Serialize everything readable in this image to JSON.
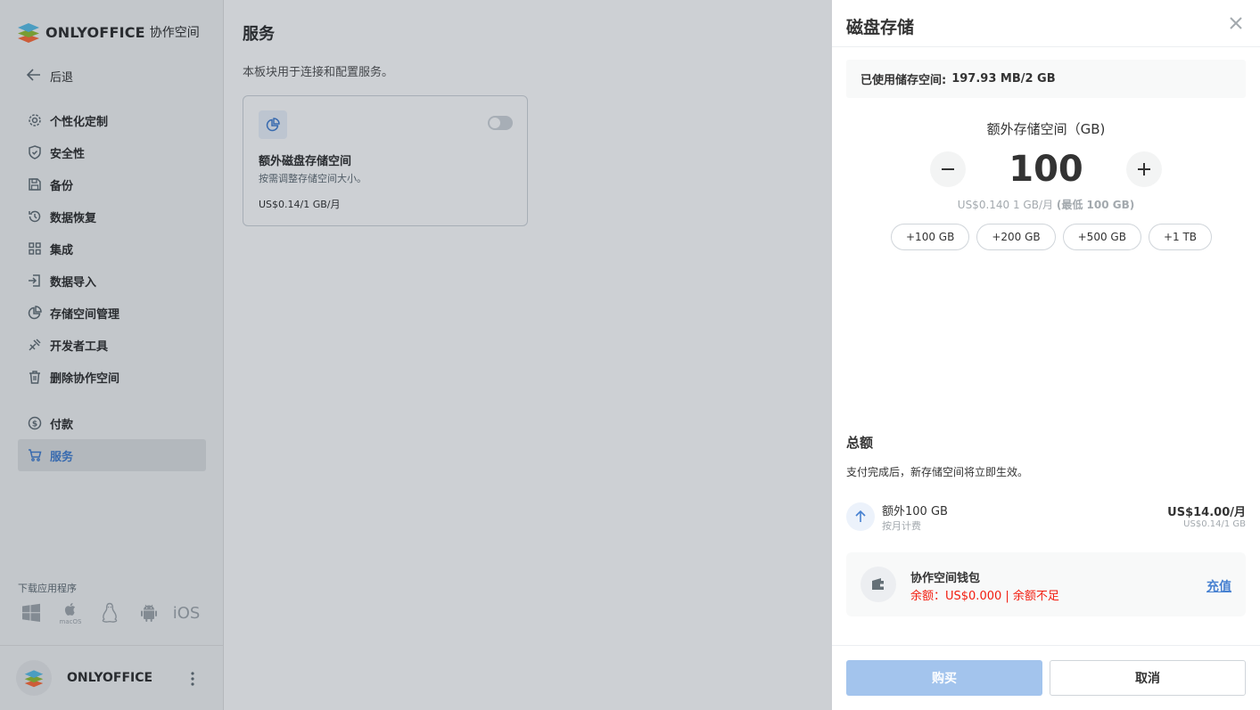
{
  "brand": {
    "name": "ONLYOFFICE",
    "subtitle": "协作空间"
  },
  "sidebar": {
    "back_label": "后退",
    "items": [
      {
        "label": "个性化定制",
        "icon": "gear-icon"
      },
      {
        "label": "安全性",
        "icon": "shield-icon"
      },
      {
        "label": "备份",
        "icon": "save-icon"
      },
      {
        "label": "数据恢复",
        "icon": "restore-icon"
      },
      {
        "label": "集成",
        "icon": "grid-icon"
      },
      {
        "label": "数据导入",
        "icon": "import-icon"
      },
      {
        "label": "存储空间管理",
        "icon": "pie-chart-icon"
      },
      {
        "label": "开发者工具",
        "icon": "tools-icon"
      },
      {
        "label": "删除协作空间",
        "icon": "trash-icon"
      }
    ],
    "items2": [
      {
        "label": "付款",
        "icon": "dollar-icon"
      },
      {
        "label": "服务",
        "icon": "cart-icon",
        "active": true
      }
    ],
    "download_label": "下载应用程序",
    "apps": [
      "windows-icon",
      "macos-icon",
      "linux-icon",
      "android-icon",
      "ios-icon"
    ],
    "macos_label": "macOS",
    "ios_label": "iOS",
    "profile_name": "ONLYOFFICE"
  },
  "main": {
    "title": "服务",
    "description": "本板块用于连接和配置服务。",
    "card": {
      "title": "额外磁盘存储空间",
      "description": "按需调整存储空间大小。",
      "price": "US$0.14/1 GB/月",
      "enabled": false
    }
  },
  "panel": {
    "title": "磁盘存储",
    "used_label": "已使用储存空间:",
    "used_value": "197.93 MB/2 GB",
    "extra_label": "额外存储空间（GB)",
    "quantity": "100",
    "unit_price": "US$0.140 1 GB/月",
    "minimum": "(最低 100 GB)",
    "presets": [
      "+100 GB",
      "+200 GB",
      "+500 GB",
      "+1 TB"
    ],
    "total_title": "总额",
    "total_desc": "支付完成后，新存储空间将立即生效。",
    "line_item": {
      "title": "额外100 GB",
      "subtitle": "按月计费",
      "price": "US$14.00/月",
      "unit": "US$0.14/1 GB"
    },
    "wallet": {
      "title": "协作空间钱包",
      "balance": "余额：US$0.000 | 余额不足",
      "topup": "充值"
    },
    "buy_label": "购买",
    "cancel_label": "取消"
  },
  "colors": {
    "accent": "#4781d1",
    "error": "#f21c0e",
    "buy_disabled": "#a3c4ed"
  }
}
